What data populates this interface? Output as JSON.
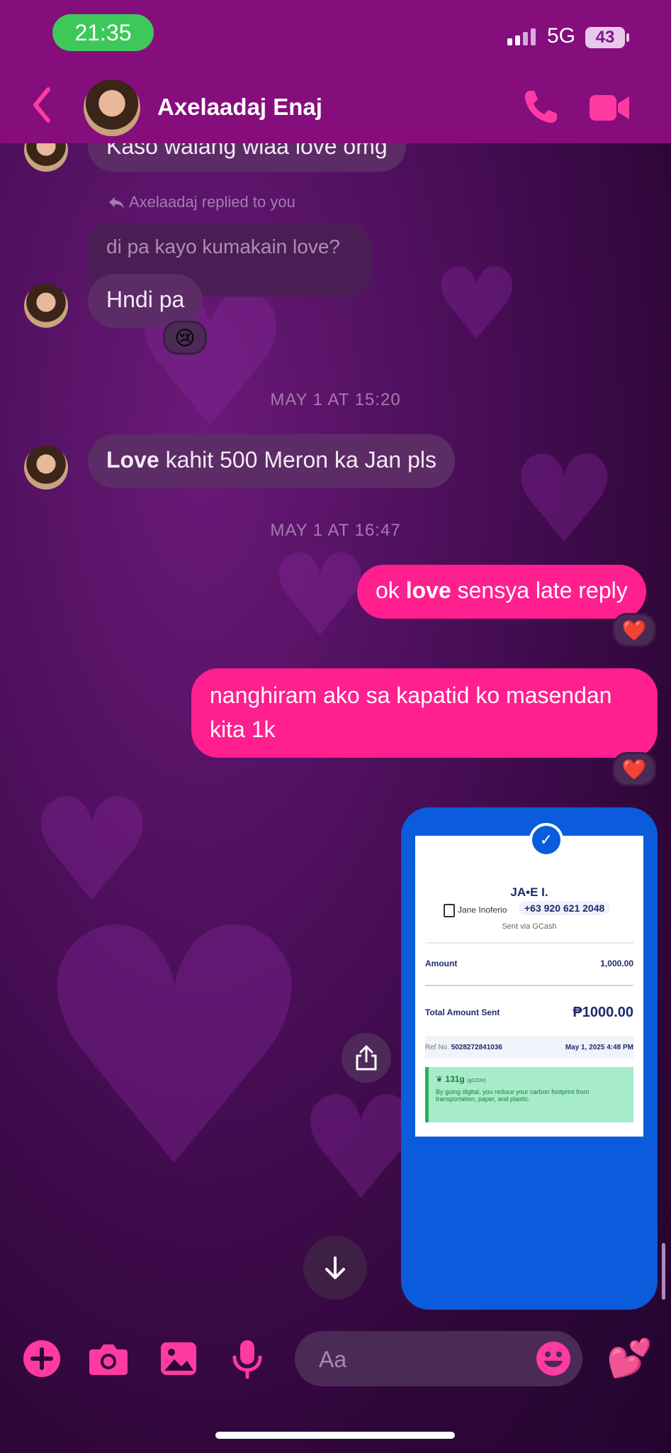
{
  "status_bar": {
    "time": "21:35",
    "network": "5G",
    "battery": "43"
  },
  "header": {
    "contact_name": "Axelaadaj Enaj"
  },
  "messages": {
    "m1": "Kaso walang wiaa love omg",
    "replied_label": "Axelaadaj replied to you",
    "quoted": "di pa kayo kumakain love?",
    "m2": "Hndi pa",
    "m2_reaction": "😢",
    "stamp1": "MAY 1 AT 15:20",
    "m3_bold": "Love",
    "m3_rest": " kahit 500 Meron ka Jan pls",
    "stamp2": "MAY 1 AT 16:47",
    "m4_pre": "ok ",
    "m4_bold": "love",
    "m4_post": " sensya late reply",
    "m4_reaction": "❤️",
    "m5_line1": "nanghiram ako sa kapatid ko masendan",
    "m5_line2": "kita 1k",
    "m5_reaction": "❤️"
  },
  "receipt": {
    "recipient": "JA•E I.",
    "name": "Jane Inoferio",
    "phone": "+63 920 621 2048",
    "via": "Sent via GCash",
    "amount_label": "Amount",
    "amount_value": "1,000.00",
    "total_label": "Total Amount Sent",
    "total_value": "₱1000.00",
    "ref_label": "Ref No.",
    "ref_value": "5028272841036",
    "date": "May 1, 2025 4:48 PM",
    "eco_value": "131g",
    "eco_unit": "(gCO2e)",
    "eco_text": "By going digital, you reduce your carbon footprint from transportation, paper, and plastic."
  },
  "composer": {
    "placeholder": "Aa"
  },
  "colors": {
    "accent": "#ff1f8e",
    "header": "#860d7c",
    "gcash_blue": "#0a5cdc"
  }
}
